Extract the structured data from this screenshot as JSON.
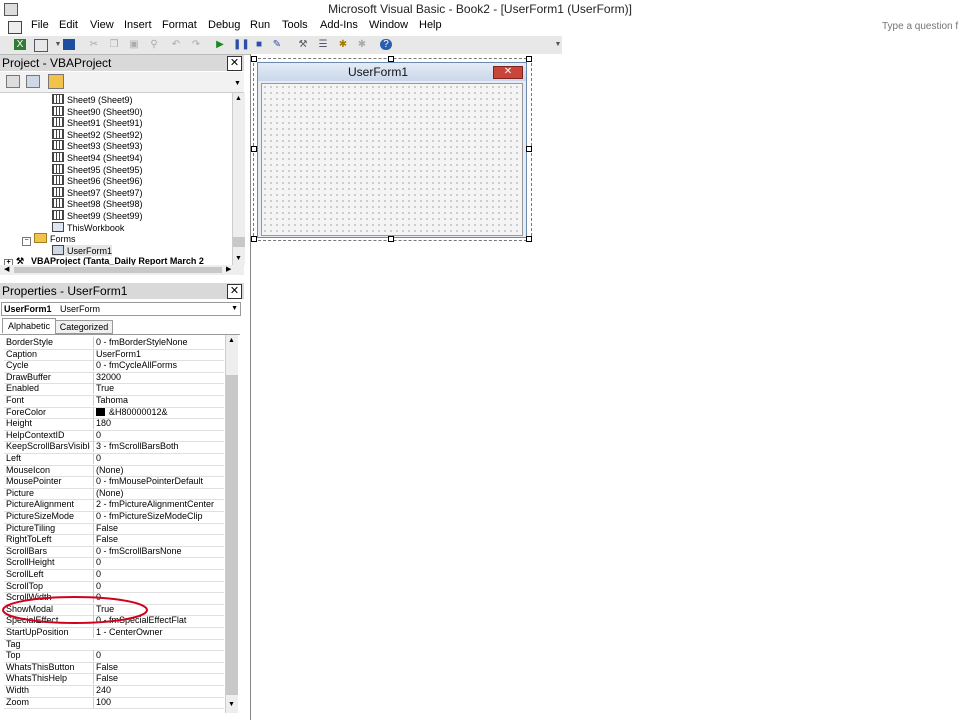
{
  "window": {
    "title": "Microsoft Visual Basic - Book2 - [UserForm1 (UserForm)]"
  },
  "menu": {
    "items": [
      "File",
      "Edit",
      "View",
      "Insert",
      "Format",
      "Debug",
      "Run",
      "Tools",
      "Add-Ins",
      "Window",
      "Help"
    ],
    "question_placeholder": "Type a question f"
  },
  "toolbar": {
    "icons": [
      "excel-view-icon",
      "insert-userform-icon",
      "save-icon",
      "cut-icon",
      "copy-icon",
      "paste-icon",
      "find-icon",
      "undo-icon",
      "redo-icon",
      "run-icon",
      "break-icon",
      "reset-icon",
      "design-mode-icon",
      "project-explorer-icon",
      "properties-window-icon",
      "object-browser-icon",
      "toolbox-icon",
      "help-icon"
    ]
  },
  "project": {
    "title": "Project - VBAProject",
    "close": "✕",
    "tree": [
      "Sheet9 (Sheet9)",
      "Sheet90 (Sheet90)",
      "Sheet91 (Sheet91)",
      "Sheet92 (Sheet92)",
      "Sheet93 (Sheet93)",
      "Sheet94 (Sheet94)",
      "Sheet95 (Sheet95)",
      "Sheet96 (Sheet96)",
      "Sheet97 (Sheet97)",
      "Sheet98 (Sheet98)",
      "Sheet99 (Sheet99)",
      "ThisWorkbook"
    ],
    "forms_folder": "Forms",
    "form_item": "UserForm1",
    "other_project": "VBAProject (Tanta_Daily Report March 2"
  },
  "properties": {
    "title": "Properties - UserForm1",
    "close": "✕",
    "object_name": "UserForm1",
    "object_type": "UserForm",
    "tabs": [
      "Alphabetic",
      "Categorized"
    ],
    "rows": [
      {
        "name": "BorderStyle",
        "value": "0 - fmBorderStyleNone"
      },
      {
        "name": "Caption",
        "value": "UserForm1"
      },
      {
        "name": "Cycle",
        "value": "0 - fmCycleAllForms"
      },
      {
        "name": "DrawBuffer",
        "value": "32000"
      },
      {
        "name": "Enabled",
        "value": "True"
      },
      {
        "name": "Font",
        "value": "Tahoma"
      },
      {
        "name": "ForeColor",
        "value": "&H80000012&"
      },
      {
        "name": "Height",
        "value": "180"
      },
      {
        "name": "HelpContextID",
        "value": "0"
      },
      {
        "name": "KeepScrollBarsVisible",
        "value": "3 - fmScrollBarsBoth"
      },
      {
        "name": "Left",
        "value": "0"
      },
      {
        "name": "MouseIcon",
        "value": "(None)"
      },
      {
        "name": "MousePointer",
        "value": "0 - fmMousePointerDefault"
      },
      {
        "name": "Picture",
        "value": "(None)"
      },
      {
        "name": "PictureAlignment",
        "value": "2 - fmPictureAlignmentCenter"
      },
      {
        "name": "PictureSizeMode",
        "value": "0 - fmPictureSizeModeClip"
      },
      {
        "name": "PictureTiling",
        "value": "False"
      },
      {
        "name": "RightToLeft",
        "value": "False"
      },
      {
        "name": "ScrollBars",
        "value": "0 - fmScrollBarsNone"
      },
      {
        "name": "ScrollHeight",
        "value": "0"
      },
      {
        "name": "ScrollLeft",
        "value": "0"
      },
      {
        "name": "ScrollTop",
        "value": "0"
      },
      {
        "name": "ScrollWidth",
        "value": "0"
      },
      {
        "name": "ShowModal",
        "value": "True"
      },
      {
        "name": "SpecialEffect",
        "value": "0 - fmSpecialEffectFlat"
      },
      {
        "name": "StartUpPosition",
        "value": "1 - CenterOwner"
      },
      {
        "name": "Tag",
        "value": ""
      },
      {
        "name": "Top",
        "value": "0"
      },
      {
        "name": "WhatsThisButton",
        "value": "False"
      },
      {
        "name": "WhatsThisHelp",
        "value": "False"
      },
      {
        "name": "Width",
        "value": "240"
      },
      {
        "name": "Zoom",
        "value": "100"
      }
    ],
    "highlight_color": "#d0021b"
  },
  "userform": {
    "caption": "UserForm1",
    "close": "✕"
  }
}
